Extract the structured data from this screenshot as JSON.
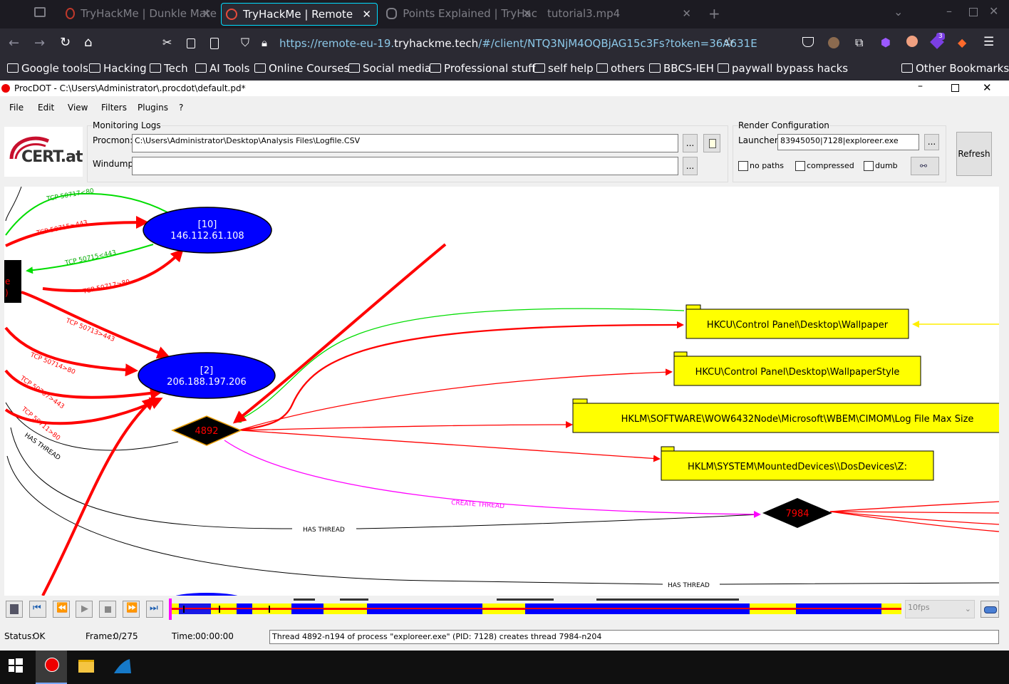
{
  "browser": {
    "tabs": [
      {
        "title": "TryHackMe | Dunkle Mate",
        "active": false
      },
      {
        "title": "TryHackMe | Remote",
        "active": true
      },
      {
        "title": "Points Explained | TryHac",
        "active": false
      },
      {
        "title": "tutorial3.mp4",
        "active": false
      }
    ],
    "url_prefix": "https://remote-eu-19.",
    "url_domain": "tryhackme.tech",
    "url_suffix": "/#/client/NTQ3NjM4OQBjAG15c3Fs?token=36A631E",
    "extension_badge": "3",
    "bookmarks": [
      "Google tools",
      "Hacking",
      "Tech",
      "AI Tools",
      "Online Courses",
      "Social media",
      "Professional stuff",
      "self help",
      "others",
      "BBCS-IEH",
      "paywall bypass hacks"
    ],
    "other_bookmarks": "Other Bookmarks"
  },
  "app": {
    "title": "ProcDOT - C:\\Users\\Administrator\\.procdot\\default.pd*",
    "menu": [
      "File",
      "Edit",
      "View",
      "Filters",
      "Plugins",
      "?"
    ],
    "logo_text": "CERT.at",
    "monitoring_logs": {
      "label": "Monitoring Logs",
      "procmon_label": "Procmon:",
      "procmon_value": "C:\\Users\\Administrator\\Desktop\\Analysis Files\\Logfile.CSV",
      "windump_label": "Windump:",
      "windump_value": "",
      "browse": "..."
    },
    "render_config": {
      "label": "Render Configuration",
      "launcher_label": "Launcher:",
      "launcher_value": "83945050|7128|exploreer.exe",
      "browse": "...",
      "no_paths": "no paths",
      "compressed": "compressed",
      "dumb": "dumb",
      "refresh": "Refresh"
    },
    "graph": {
      "nodes": {
        "ip10_id": "[10]",
        "ip10_addr": "146.112.61.108",
        "ip2_id": "[2]",
        "ip2_addr": "206.188.197.206",
        "thread_4892": "4892",
        "thread_7984": "7984",
        "proc_partial_1": "e",
        "proc_partial_2": ")"
      },
      "registry": [
        "HKCU\\Control Panel\\Desktop\\Wallpaper",
        "HKCU\\Control Panel\\Desktop\\WallpaperStyle",
        "HKLM\\SOFTWARE\\WOW6432Node\\Microsoft\\WBEM\\CIMOM\\Log File Max Size",
        "HKLM\\SYSTEM\\MountedDevices\\\\DosDevices\\Z:"
      ],
      "edges": {
        "e1": "TCP 50717<80",
        "e2": "TCP 50715>443",
        "e3": "TCP 50715<443",
        "e4": "TCP 50717>80",
        "e5": "TCP 50713>443",
        "e6": "TCP 50714>80",
        "e7": "TCP 50707>443",
        "e8": "TCP 50711>80",
        "e9": "HAS THREAD",
        "e10": "HAS THREAD",
        "e11": "HAS THREAD",
        "e12": "CREATE THREAD"
      }
    },
    "playback": {
      "fps": "10fps"
    },
    "status": {
      "status_label": "Status:",
      "status_value": "OK",
      "frame_label": "Frame:",
      "frame_value": "0/275",
      "time_label": "Time:",
      "time_value": "00:00:00",
      "message": "Thread 4892-n194 of process \"exploreer.exe\" (PID: 7128) creates thread 7984-n204"
    }
  },
  "colors": {
    "tcp_out": "#ff0000",
    "tcp_in": "#00dd00",
    "ip_node": "#0000ff",
    "registry": "#ffff00",
    "create_thread": "#ff00ff"
  }
}
